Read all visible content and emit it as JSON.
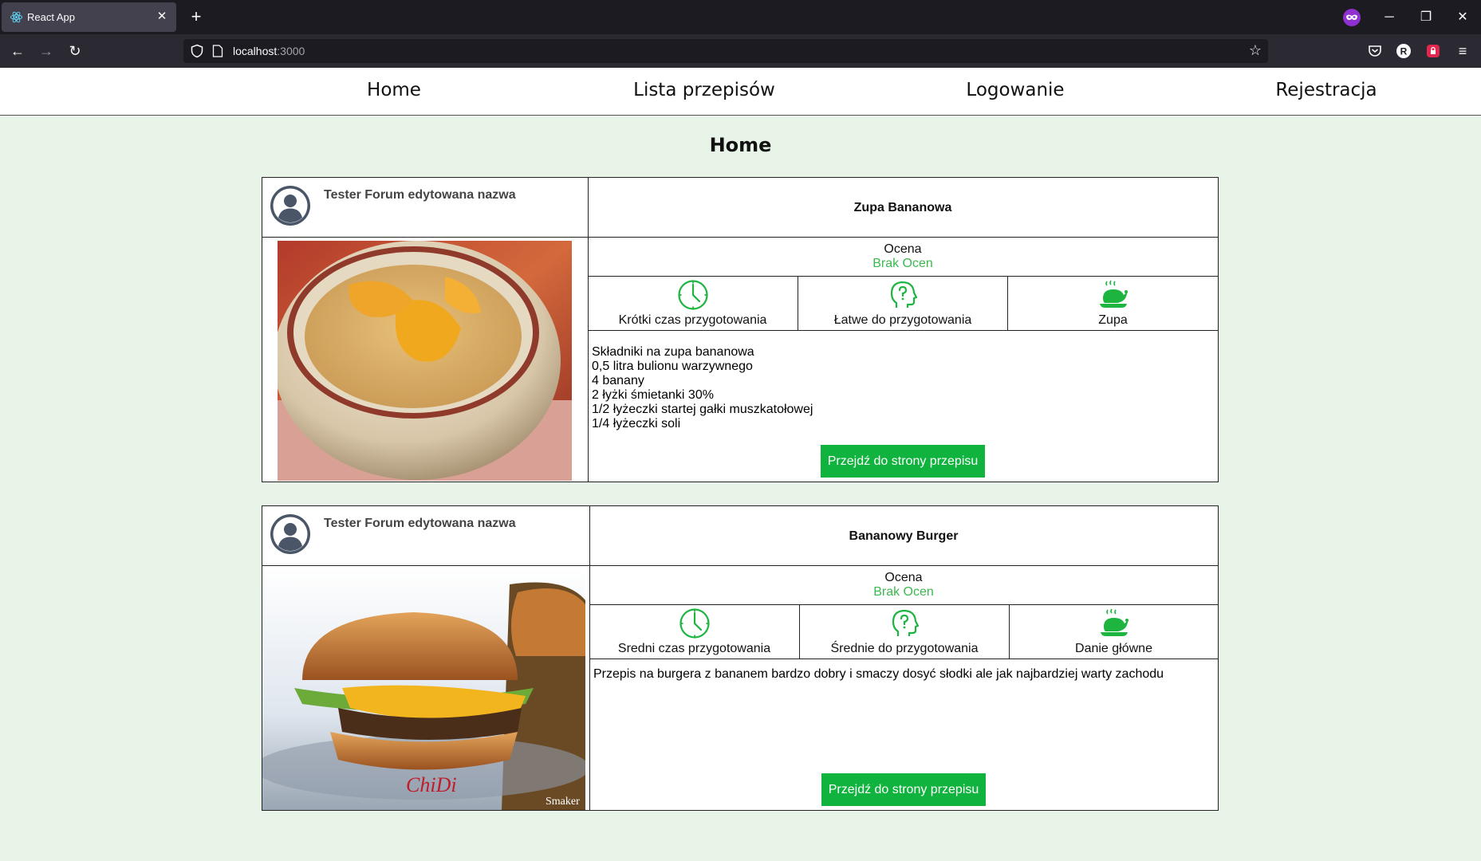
{
  "browser": {
    "tab_title": "React App",
    "url_host": "localhost",
    "url_port": ":3000",
    "new_tab": "+",
    "close": "✕"
  },
  "site_nav": {
    "items": [
      "Home",
      "Lista przepisów",
      "Logowanie",
      "Rejestracja"
    ]
  },
  "page_title": "Home",
  "recipes": [
    {
      "author": "Tester Forum edytowana nazwa",
      "title": "Zupa Bananowa",
      "rating_label": "Ocena",
      "rating_value": "Brak Ocen",
      "time": "Krótki czas przygotowania",
      "difficulty": "Łatwe do przygotowania",
      "category": "Zupa",
      "description": "Składniki na zupa bananowa\n0,5 litra bulionu warzywnego\n4 banany\n2 łyżki śmietanki 30%\n1/2 łyżeczki startej gałki muszkatołowej\n1/4 łyżeczki soli",
      "button": "Przejdź do strony przepisu"
    },
    {
      "author": "Tester Forum edytowana nazwa",
      "title": "Bananowy Burger",
      "rating_label": "Ocena",
      "rating_value": "Brak Ocen",
      "time": "Sredni czas przygotowania",
      "difficulty": "Średnie do przygotowania",
      "category": "Danie główne",
      "description": "Przepis na burgera z bananem bardzo dobry i smaczy dosyć słodki ale jak najbardziej warty zachodu",
      "button": "Przejdź do strony przepisu",
      "photo_watermark": "Smaker",
      "photo_logo": "ChiDi"
    }
  ],
  "colors": {
    "page_bg": "#e8f4e8",
    "accent_green": "#0fb33d",
    "rating_green": "#3bb84f",
    "icon_green": "#1db540"
  }
}
